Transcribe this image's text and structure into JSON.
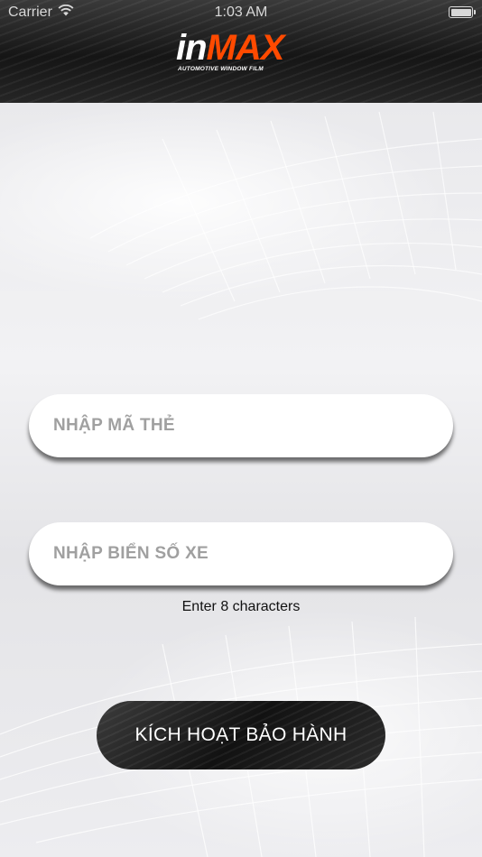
{
  "status_bar": {
    "carrier": "Carrier",
    "time": "1:03 AM",
    "wifi_icon": "wifi-icon",
    "battery_icon": "battery-icon"
  },
  "header": {
    "logo_in": "in",
    "logo_max": "MAX",
    "logo_tagline": "AUTOMOTIVE WINDOW FILM"
  },
  "form": {
    "card_code_placeholder": "NHẬP MÃ THẺ",
    "plate_placeholder": "NHẬP BIỂN SỐ XE",
    "plate_hint": "Enter 8 characters",
    "activate_label": "KÍCH HOẠT BẢO HÀNH"
  },
  "colors": {
    "brand_orange": "#ff4a00",
    "header_dark": "#151515",
    "placeholder_gray": "#a0a0a0"
  }
}
